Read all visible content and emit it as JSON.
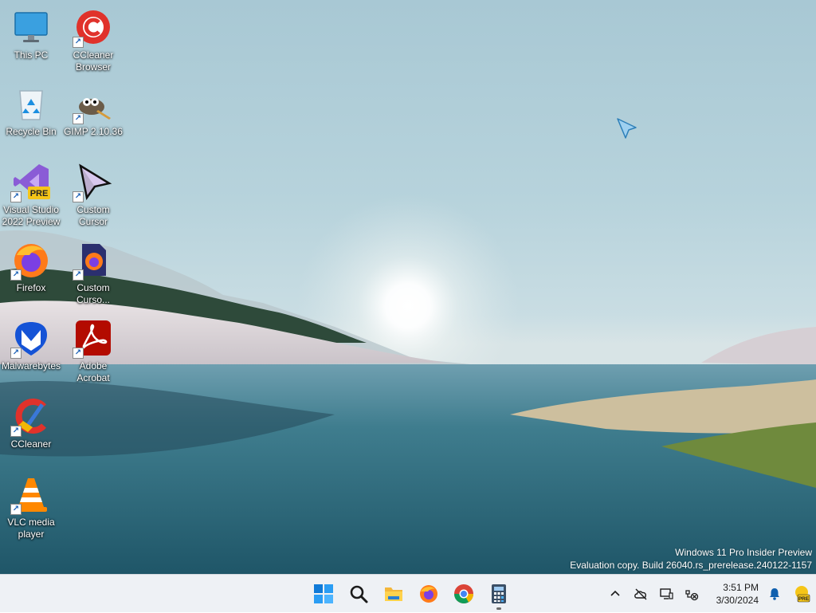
{
  "desktop": {
    "icons": [
      {
        "label": "This PC",
        "icon": "monitor-icon",
        "shortcut": false
      },
      {
        "label": "CCleaner Browser",
        "icon": "ccleaner-browser-icon",
        "shortcut": true
      },
      {
        "label": "Recycle Bin",
        "icon": "recycle-bin-icon",
        "shortcut": false
      },
      {
        "label": "GIMP 2.10.36",
        "icon": "gimp-icon",
        "shortcut": true
      },
      {
        "label": "Visual Studio 2022 Preview",
        "icon": "visual-studio-icon",
        "shortcut": true,
        "badge": "PRE"
      },
      {
        "label": "Custom Cursor",
        "icon": "cursor-arrow-icon",
        "shortcut": true
      },
      {
        "label": "Firefox",
        "icon": "firefox-icon",
        "shortcut": true
      },
      {
        "label": "Custom Curso...",
        "icon": "custom-cursor-firefox-icon",
        "shortcut": true
      },
      {
        "label": "Malwarebytes",
        "icon": "malwarebytes-icon",
        "shortcut": true
      },
      {
        "label": "Adobe Acrobat",
        "icon": "adobe-acrobat-icon",
        "shortcut": true
      },
      {
        "label": "CCleaner",
        "icon": "ccleaner-icon",
        "shortcut": true
      },
      {
        "label": "VLC media player",
        "icon": "vlc-icon",
        "shortcut": true
      }
    ],
    "watermark": {
      "line1": "Windows 11 Pro Insider Preview",
      "line2": "Evaluation copy. Build 26040.rs_prerelease.240122-1157"
    }
  },
  "taskbar": {
    "apps": [
      {
        "name": "Start",
        "icon": "windows-start-icon",
        "active": false
      },
      {
        "name": "Search",
        "icon": "search-icon",
        "active": false
      },
      {
        "name": "File Explorer",
        "icon": "folder-icon",
        "active": false
      },
      {
        "name": "Firefox",
        "icon": "firefox-icon",
        "active": false
      },
      {
        "name": "Chrome",
        "icon": "chrome-icon",
        "active": false
      },
      {
        "name": "Calculator",
        "icon": "calculator-icon",
        "active": true
      }
    ],
    "tray": {
      "icons": [
        "chevron-up-icon",
        "cloud-offline-icon",
        "display-icon",
        "network-disconnected-icon"
      ],
      "time": "3:51 PM",
      "date": "3/30/2024",
      "badge": "PRE"
    }
  },
  "colors": {
    "taskbar_bg": "#eef1f5",
    "accent": "#0067c0"
  }
}
